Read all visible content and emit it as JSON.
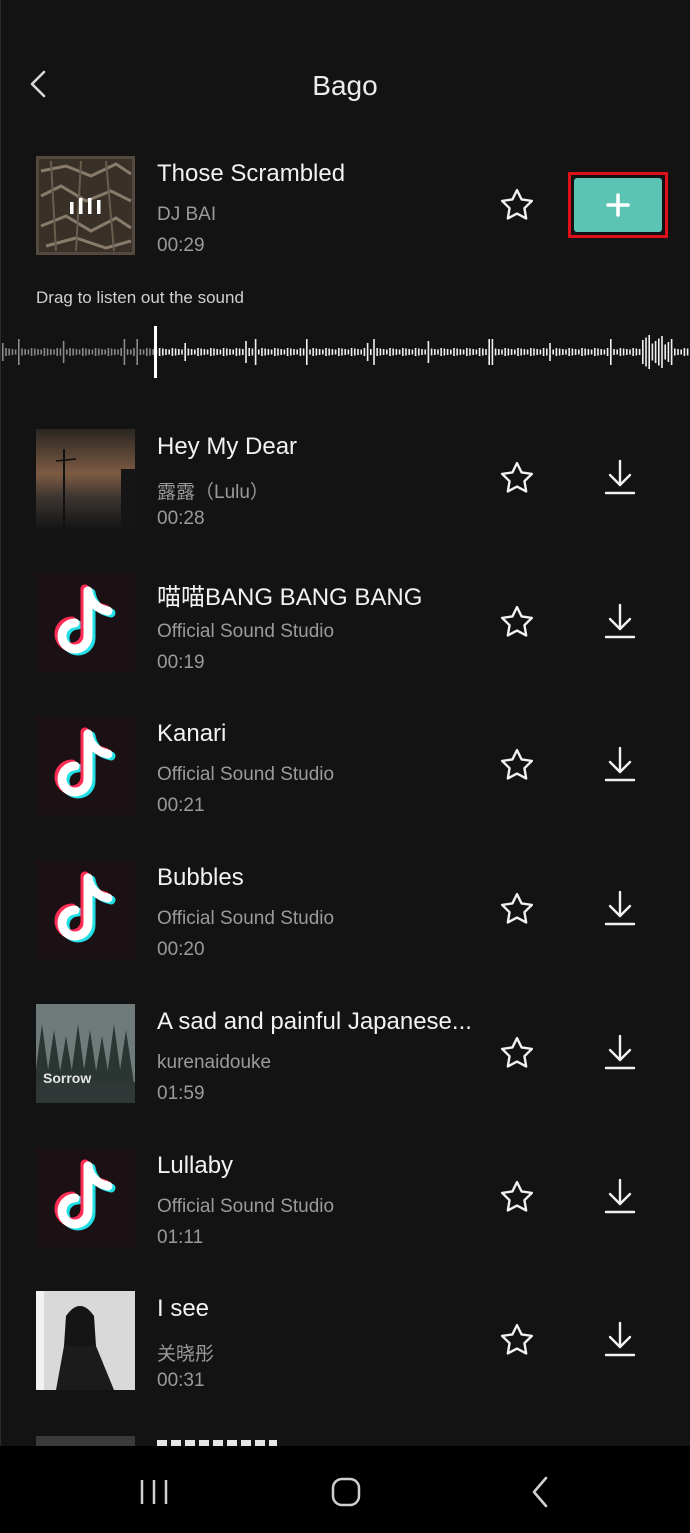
{
  "header": {
    "title": "Bago"
  },
  "featured": {
    "title": "Those Scrambled",
    "artist": "DJ BAI",
    "duration": "00:29",
    "hint": "Drag to listen out the sound",
    "accent_color": "#5cc4b4",
    "highlight_color": "#e0101a"
  },
  "songs": [
    {
      "title": "Hey My Dear",
      "artist": "露露（Lulu）",
      "duration": "00:28"
    },
    {
      "title": "喵喵BANG BANG BANG",
      "artist": "Official Sound Studio",
      "duration": "00:19"
    },
    {
      "title": "Kanari",
      "artist": "Official Sound Studio",
      "duration": "00:21"
    },
    {
      "title": "Bubbles",
      "artist": "Official Sound Studio",
      "duration": "00:20"
    },
    {
      "title": "A sad and painful Japanese...",
      "artist": "kurenaidouke",
      "duration": "01:59",
      "cover_text": "Sorrow"
    },
    {
      "title": "Lullaby",
      "artist": "Official Sound Studio",
      "duration": "01:11"
    },
    {
      "title": "I see",
      "artist": "关晓彤",
      "duration": "00:31"
    }
  ],
  "icons": {
    "back": "chevron-left-icon",
    "favorite": "star-outline-icon",
    "download": "download-icon",
    "add": "plus-icon",
    "nav_recents": "recents-icon",
    "nav_home": "home-icon",
    "nav_back": "back-icon"
  }
}
